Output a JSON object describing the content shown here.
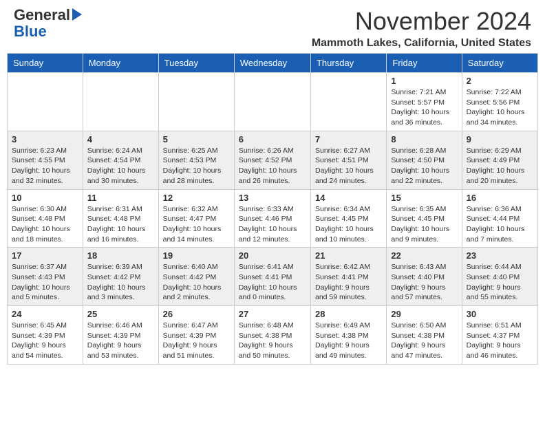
{
  "header": {
    "logo_line1": "General",
    "logo_line2": "Blue",
    "month": "November 2024",
    "location": "Mammoth Lakes, California, United States"
  },
  "weekdays": [
    "Sunday",
    "Monday",
    "Tuesday",
    "Wednesday",
    "Thursday",
    "Friday",
    "Saturday"
  ],
  "rows": [
    {
      "cells": [
        {
          "day": "",
          "info": ""
        },
        {
          "day": "",
          "info": ""
        },
        {
          "day": "",
          "info": ""
        },
        {
          "day": "",
          "info": ""
        },
        {
          "day": "",
          "info": ""
        },
        {
          "day": "1",
          "info": "Sunrise: 7:21 AM\nSunset: 5:57 PM\nDaylight: 10 hours\nand 36 minutes."
        },
        {
          "day": "2",
          "info": "Sunrise: 7:22 AM\nSunset: 5:56 PM\nDaylight: 10 hours\nand 34 minutes."
        }
      ]
    },
    {
      "cells": [
        {
          "day": "3",
          "info": "Sunrise: 6:23 AM\nSunset: 4:55 PM\nDaylight: 10 hours\nand 32 minutes."
        },
        {
          "day": "4",
          "info": "Sunrise: 6:24 AM\nSunset: 4:54 PM\nDaylight: 10 hours\nand 30 minutes."
        },
        {
          "day": "5",
          "info": "Sunrise: 6:25 AM\nSunset: 4:53 PM\nDaylight: 10 hours\nand 28 minutes."
        },
        {
          "day": "6",
          "info": "Sunrise: 6:26 AM\nSunset: 4:52 PM\nDaylight: 10 hours\nand 26 minutes."
        },
        {
          "day": "7",
          "info": "Sunrise: 6:27 AM\nSunset: 4:51 PM\nDaylight: 10 hours\nand 24 minutes."
        },
        {
          "day": "8",
          "info": "Sunrise: 6:28 AM\nSunset: 4:50 PM\nDaylight: 10 hours\nand 22 minutes."
        },
        {
          "day": "9",
          "info": "Sunrise: 6:29 AM\nSunset: 4:49 PM\nDaylight: 10 hours\nand 20 minutes."
        }
      ]
    },
    {
      "cells": [
        {
          "day": "10",
          "info": "Sunrise: 6:30 AM\nSunset: 4:48 PM\nDaylight: 10 hours\nand 18 minutes."
        },
        {
          "day": "11",
          "info": "Sunrise: 6:31 AM\nSunset: 4:48 PM\nDaylight: 10 hours\nand 16 minutes."
        },
        {
          "day": "12",
          "info": "Sunrise: 6:32 AM\nSunset: 4:47 PM\nDaylight: 10 hours\nand 14 minutes."
        },
        {
          "day": "13",
          "info": "Sunrise: 6:33 AM\nSunset: 4:46 PM\nDaylight: 10 hours\nand 12 minutes."
        },
        {
          "day": "14",
          "info": "Sunrise: 6:34 AM\nSunset: 4:45 PM\nDaylight: 10 hours\nand 10 minutes."
        },
        {
          "day": "15",
          "info": "Sunrise: 6:35 AM\nSunset: 4:45 PM\nDaylight: 10 hours\nand 9 minutes."
        },
        {
          "day": "16",
          "info": "Sunrise: 6:36 AM\nSunset: 4:44 PM\nDaylight: 10 hours\nand 7 minutes."
        }
      ]
    },
    {
      "cells": [
        {
          "day": "17",
          "info": "Sunrise: 6:37 AM\nSunset: 4:43 PM\nDaylight: 10 hours\nand 5 minutes."
        },
        {
          "day": "18",
          "info": "Sunrise: 6:39 AM\nSunset: 4:42 PM\nDaylight: 10 hours\nand 3 minutes."
        },
        {
          "day": "19",
          "info": "Sunrise: 6:40 AM\nSunset: 4:42 PM\nDaylight: 10 hours\nand 2 minutes."
        },
        {
          "day": "20",
          "info": "Sunrise: 6:41 AM\nSunset: 4:41 PM\nDaylight: 10 hours\nand 0 minutes."
        },
        {
          "day": "21",
          "info": "Sunrise: 6:42 AM\nSunset: 4:41 PM\nDaylight: 9 hours\nand 59 minutes."
        },
        {
          "day": "22",
          "info": "Sunrise: 6:43 AM\nSunset: 4:40 PM\nDaylight: 9 hours\nand 57 minutes."
        },
        {
          "day": "23",
          "info": "Sunrise: 6:44 AM\nSunset: 4:40 PM\nDaylight: 9 hours\nand 55 minutes."
        }
      ]
    },
    {
      "cells": [
        {
          "day": "24",
          "info": "Sunrise: 6:45 AM\nSunset: 4:39 PM\nDaylight: 9 hours\nand 54 minutes."
        },
        {
          "day": "25",
          "info": "Sunrise: 6:46 AM\nSunset: 4:39 PM\nDaylight: 9 hours\nand 53 minutes."
        },
        {
          "day": "26",
          "info": "Sunrise: 6:47 AM\nSunset: 4:39 PM\nDaylight: 9 hours\nand 51 minutes."
        },
        {
          "day": "27",
          "info": "Sunrise: 6:48 AM\nSunset: 4:38 PM\nDaylight: 9 hours\nand 50 minutes."
        },
        {
          "day": "28",
          "info": "Sunrise: 6:49 AM\nSunset: 4:38 PM\nDaylight: 9 hours\nand 49 minutes."
        },
        {
          "day": "29",
          "info": "Sunrise: 6:50 AM\nSunset: 4:38 PM\nDaylight: 9 hours\nand 47 minutes."
        },
        {
          "day": "30",
          "info": "Sunrise: 6:51 AM\nSunset: 4:37 PM\nDaylight: 9 hours\nand 46 minutes."
        }
      ]
    }
  ]
}
